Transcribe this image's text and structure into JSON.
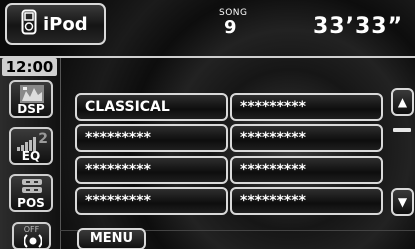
{
  "header": {
    "source_label": "iPod",
    "song_label": "SONG",
    "song_number": "9",
    "elapsed_time": "33’33”"
  },
  "sidebar": {
    "clock": "12:00",
    "dsp_label": "DSP",
    "eq_label": "EQ",
    "eq_number": "2",
    "pos_label": "POS",
    "off_label": "OFF"
  },
  "tracks": [
    "CLASSICAL",
    "*********",
    "*********",
    "*********",
    "*********",
    "*********",
    "*********",
    "*********"
  ],
  "footer": {
    "menu_label": "MENU"
  },
  "icons": {
    "source": "ipod-icon",
    "dsp": "dsp-icon",
    "eq": "equalizer-icon",
    "pos": "position-icon",
    "off": "speaker-off-icon",
    "scroll_up": "triangle-up-icon",
    "scroll_down": "triangle-down-icon"
  }
}
